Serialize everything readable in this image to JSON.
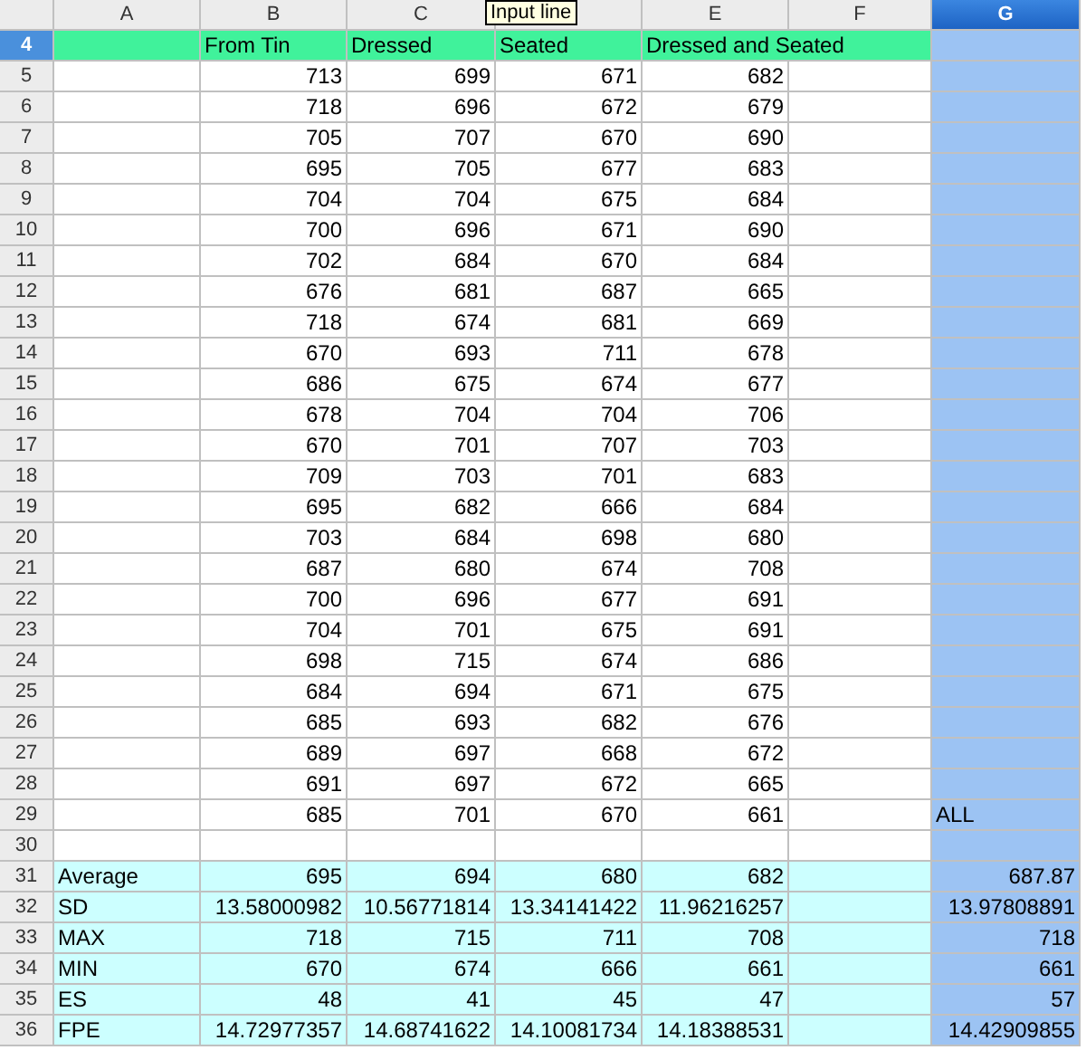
{
  "tooltip": {
    "text": "Input line"
  },
  "columns": [
    {
      "label": "A",
      "selected": false
    },
    {
      "label": "B",
      "selected": false
    },
    {
      "label": "C",
      "selected": false
    },
    {
      "selected": false
    },
    {
      "label": "E",
      "selected": false
    },
    {
      "label": "F",
      "selected": false
    },
    {
      "label": "G",
      "selected": true
    }
  ],
  "rows": [
    {
      "number": "4",
      "kind": "header",
      "selected": true,
      "values": [
        "From Tin",
        "Dressed",
        "Seated",
        "Dressed and Seated"
      ]
    },
    {
      "number": "5",
      "kind": "data",
      "selected": false,
      "values": [
        "713",
        "699",
        "671",
        "682"
      ]
    },
    {
      "number": "6",
      "kind": "data",
      "selected": false,
      "values": [
        "718",
        "696",
        "672",
        "679"
      ]
    },
    {
      "number": "7",
      "kind": "data",
      "selected": false,
      "values": [
        "705",
        "707",
        "670",
        "690"
      ]
    },
    {
      "number": "8",
      "kind": "data",
      "selected": false,
      "values": [
        "695",
        "705",
        "677",
        "683"
      ]
    },
    {
      "number": "9",
      "kind": "data",
      "selected": false,
      "values": [
        "704",
        "704",
        "675",
        "684"
      ]
    },
    {
      "number": "10",
      "kind": "data",
      "selected": false,
      "values": [
        "700",
        "696",
        "671",
        "690"
      ]
    },
    {
      "number": "11",
      "kind": "data",
      "selected": false,
      "values": [
        "702",
        "684",
        "670",
        "684"
      ]
    },
    {
      "number": "12",
      "kind": "data",
      "selected": false,
      "values": [
        "676",
        "681",
        "687",
        "665"
      ]
    },
    {
      "number": "13",
      "kind": "data",
      "selected": false,
      "values": [
        "718",
        "674",
        "681",
        "669"
      ]
    },
    {
      "number": "14",
      "kind": "data",
      "selected": false,
      "values": [
        "670",
        "693",
        "711",
        "678"
      ]
    },
    {
      "number": "15",
      "kind": "data",
      "selected": false,
      "values": [
        "686",
        "675",
        "674",
        "677"
      ]
    },
    {
      "number": "16",
      "kind": "data",
      "selected": false,
      "values": [
        "678",
        "704",
        "704",
        "706"
      ]
    },
    {
      "number": "17",
      "kind": "data",
      "selected": false,
      "values": [
        "670",
        "701",
        "707",
        "703"
      ]
    },
    {
      "number": "18",
      "kind": "data",
      "selected": false,
      "values": [
        "709",
        "703",
        "701",
        "683"
      ]
    },
    {
      "number": "19",
      "kind": "data",
      "selected": false,
      "values": [
        "695",
        "682",
        "666",
        "684"
      ]
    },
    {
      "number": "20",
      "kind": "data",
      "selected": false,
      "values": [
        "703",
        "684",
        "698",
        "680"
      ]
    },
    {
      "number": "21",
      "kind": "data",
      "selected": false,
      "values": [
        "687",
        "680",
        "674",
        "708"
      ]
    },
    {
      "number": "22",
      "kind": "data",
      "selected": false,
      "values": [
        "700",
        "696",
        "677",
        "691"
      ]
    },
    {
      "number": "23",
      "kind": "data",
      "selected": false,
      "values": [
        "704",
        "701",
        "675",
        "691"
      ]
    },
    {
      "number": "24",
      "kind": "data",
      "selected": false,
      "values": [
        "698",
        "715",
        "674",
        "686"
      ]
    },
    {
      "number": "25",
      "kind": "data",
      "selected": false,
      "values": [
        "684",
        "694",
        "671",
        "675"
      ]
    },
    {
      "number": "26",
      "kind": "data",
      "selected": false,
      "values": [
        "685",
        "693",
        "682",
        "676"
      ]
    },
    {
      "number": "27",
      "kind": "data",
      "selected": false,
      "values": [
        "689",
        "697",
        "668",
        "672"
      ]
    },
    {
      "number": "28",
      "kind": "data",
      "selected": false,
      "values": [
        "691",
        "697",
        "672",
        "665"
      ]
    },
    {
      "number": "29",
      "kind": "data",
      "selected": false,
      "values": [
        "685",
        "701",
        "670",
        "661"
      ],
      "note": "ALL"
    },
    {
      "number": "30",
      "kind": "blank",
      "selected": false
    },
    {
      "number": "31",
      "kind": "stats",
      "selected": false,
      "label": "Average",
      "values": [
        "695",
        "694",
        "680",
        "682"
      ],
      "total": "687.87"
    },
    {
      "number": "32",
      "kind": "stats",
      "selected": false,
      "label": "SD",
      "values": [
        "13.58000982",
        "10.56771814",
        "13.34141422",
        "11.96216257"
      ],
      "total": "13.97808891"
    },
    {
      "number": "33",
      "kind": "stats",
      "selected": false,
      "label": "MAX",
      "values": [
        "718",
        "715",
        "711",
        "708"
      ],
      "total": "718"
    },
    {
      "number": "34",
      "kind": "stats",
      "selected": false,
      "label": "MIN",
      "values": [
        "670",
        "674",
        "666",
        "661"
      ],
      "total": "661"
    },
    {
      "number": "35",
      "kind": "stats",
      "selected": false,
      "label": "ES",
      "values": [
        "48",
        "41",
        "45",
        "47"
      ],
      "total": "57"
    },
    {
      "number": "36",
      "kind": "stats",
      "selected": false,
      "label": "FPE",
      "values": [
        "14.72977357",
        "14.68741622",
        "14.10081734",
        "14.18388531"
      ],
      "total": "14.42909855"
    }
  ]
}
